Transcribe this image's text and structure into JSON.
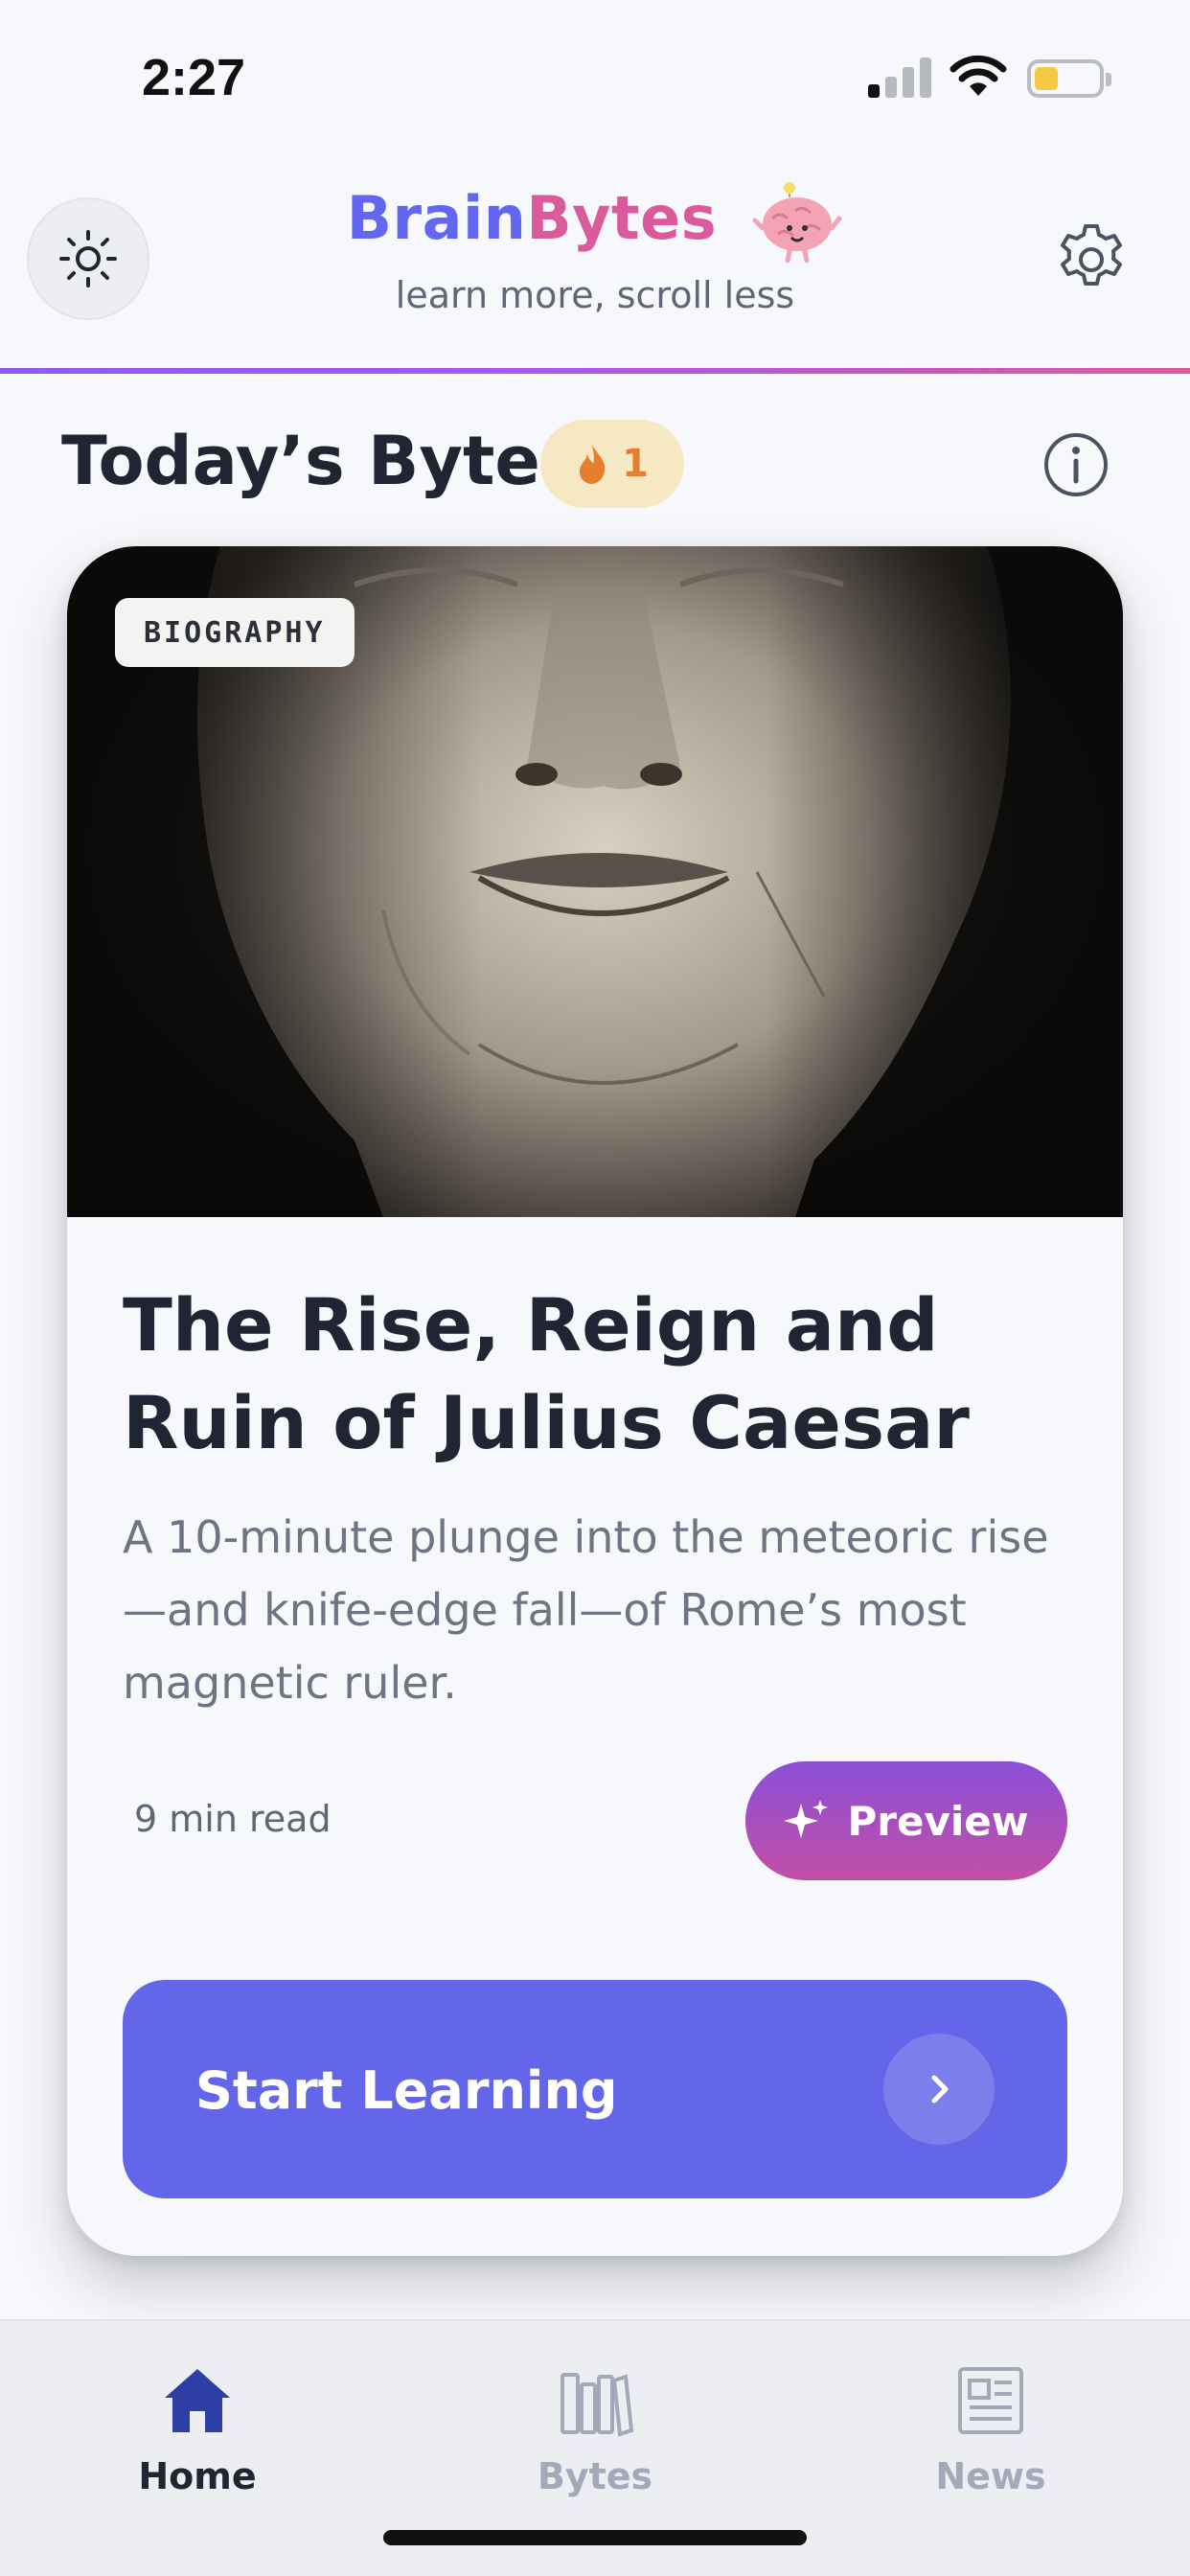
{
  "status_bar": {
    "time": "2:27",
    "battery_color": "#f5c944"
  },
  "header": {
    "brand_part1": "Brain",
    "brand_part2": "Bytes",
    "tagline": "learn more, scroll less",
    "theme_icon": "sun-icon",
    "settings_icon": "gear-icon",
    "mascot_icon": "brain-mascot-icon",
    "accent_colors": {
      "primary": "#6366f1",
      "pink": "#db5a9c"
    }
  },
  "section": {
    "title": "Today’s Byte",
    "streak_count": "1",
    "streak_icon": "flame-icon",
    "info_icon": "info-icon"
  },
  "card": {
    "category": "BIOGRAPHY",
    "image_subject": "marble bust of Julius Caesar",
    "title": "The Rise, Reign and Ruin of Julius Caesar",
    "description": "A 10-minute plunge into the meteoric rise—and knife-edge fall—of Rome’s most magnetic ruler.",
    "read_time": "9 min read",
    "preview_label": "Preview",
    "preview_icon": "sparkles-icon",
    "start_label": "Start Learning",
    "start_icon": "chevron-right-icon"
  },
  "tabs": [
    {
      "label": "Home",
      "icon": "home-icon",
      "active": true
    },
    {
      "label": "Bytes",
      "icon": "books-icon",
      "active": false
    },
    {
      "label": "News",
      "icon": "newspaper-icon",
      "active": false
    }
  ]
}
